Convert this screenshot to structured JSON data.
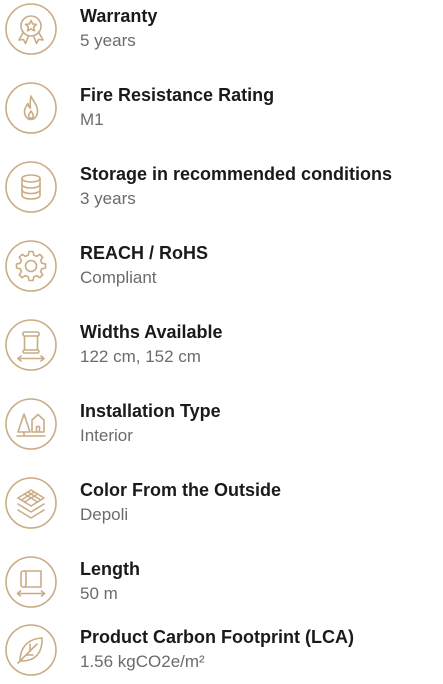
{
  "specs": [
    {
      "icon": "award-badge-icon",
      "title": "Warranty",
      "value": "5 years"
    },
    {
      "icon": "flame-icon",
      "title": "Fire Resistance Rating",
      "value": "M1"
    },
    {
      "icon": "database-storage-icon",
      "title": "Storage in recommended conditions",
      "value": "3 years"
    },
    {
      "icon": "gear-icon",
      "title": "REACH / RoHS",
      "value": "Compliant"
    },
    {
      "icon": "roll-width-icon",
      "title": "Widths Available",
      "value": "122 cm, 152 cm"
    },
    {
      "icon": "tree-house-icon",
      "title": "Installation Type",
      "value": "Interior"
    },
    {
      "icon": "layers-icon",
      "title": "Color From the Outside",
      "value": "Depoli"
    },
    {
      "icon": "roll-length-icon",
      "title": "Length",
      "value": "50 m"
    },
    {
      "icon": "leaf-icon",
      "title": "Product Carbon Footprint (LCA)",
      "value": "1.56 kgCO2e/m²"
    }
  ],
  "colors": {
    "icon_stroke": "#c9ac84",
    "title": "#1a1a1a",
    "value": "#6b6b6b"
  }
}
